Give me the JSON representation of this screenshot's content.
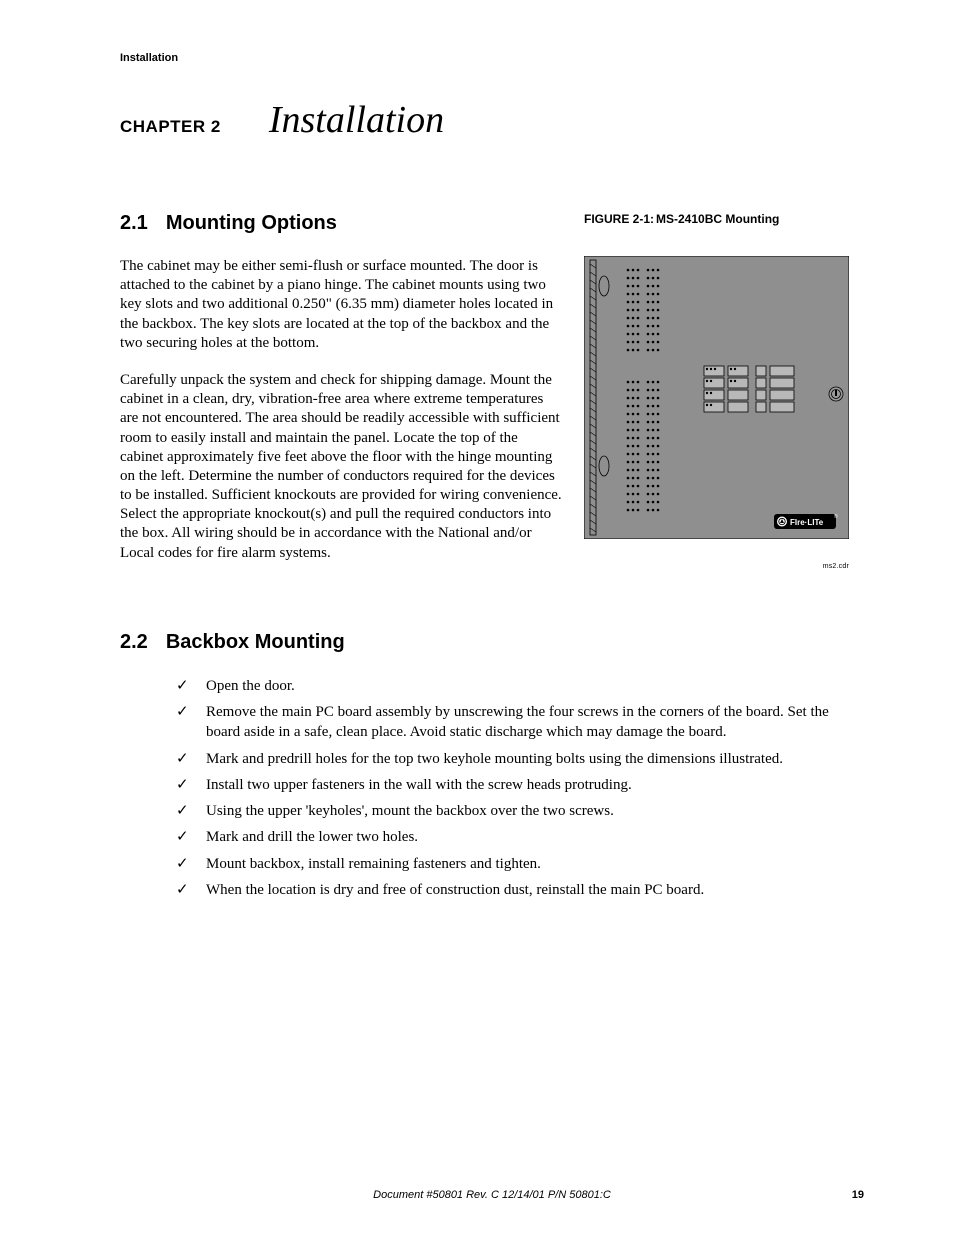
{
  "running_head": "Installation",
  "chapter": {
    "label": "CHAPTER 2",
    "title": "Installation"
  },
  "section1": {
    "number": "2.1",
    "title": "Mounting Options",
    "para1": "The cabinet may be either semi-flush or surface mounted.  The door is attached to the cabinet by a piano hinge.  The cabinet mounts using two key slots and two additional 0.250\" (6.35 mm) diameter holes located in the backbox.  The key slots are located at the top of the backbox and the two securing holes at the bottom.",
    "para2": "Carefully unpack the system and check for shipping damage.  Mount the cabinet in a clean, dry, vibration-free area where extreme temperatures are not encountered.  The area should be readily accessible with sufficient room to easily install and maintain the panel.  Locate the top of the cabinet approximately five feet above the floor with the hinge mounting on the left.  Determine the number of conductors required for the devices to be installed.  Sufficient knockouts are provided for wiring convenience.  Select the appropriate knockout(s) and pull the required conductors into the box.  All wiring should be in accordance with the National and/or Local codes for fire alarm systems."
  },
  "figure": {
    "label": "FIGURE 2-1:",
    "caption": "MS-2410BC Mounting",
    "brand": "FIre·LITe",
    "drawing_id": "ms2.cdr"
  },
  "section2": {
    "number": "2.2",
    "title": "Backbox Mounting",
    "items": [
      "Open the door.",
      "Remove the main PC board assembly by unscrewing the four screws in the corners of the board.  Set the board aside in a safe, clean place.  Avoid static discharge which may damage the board.",
      "Mark and predrill holes for the top two keyhole mounting bolts using the dimensions illustrated.",
      "Install two upper fasteners in the wall with the screw heads protruding.",
      "Using the upper 'keyholes', mount the backbox over the two screws.",
      "Mark and drill the lower two holes.",
      "Mount backbox, install remaining fasteners and tighten.",
      "When the location is dry and free of construction dust, reinstall the main PC board."
    ]
  },
  "footer": {
    "center": "Document #50801    Rev. C    12/14/01    P/N 50801:C",
    "page": "19"
  }
}
